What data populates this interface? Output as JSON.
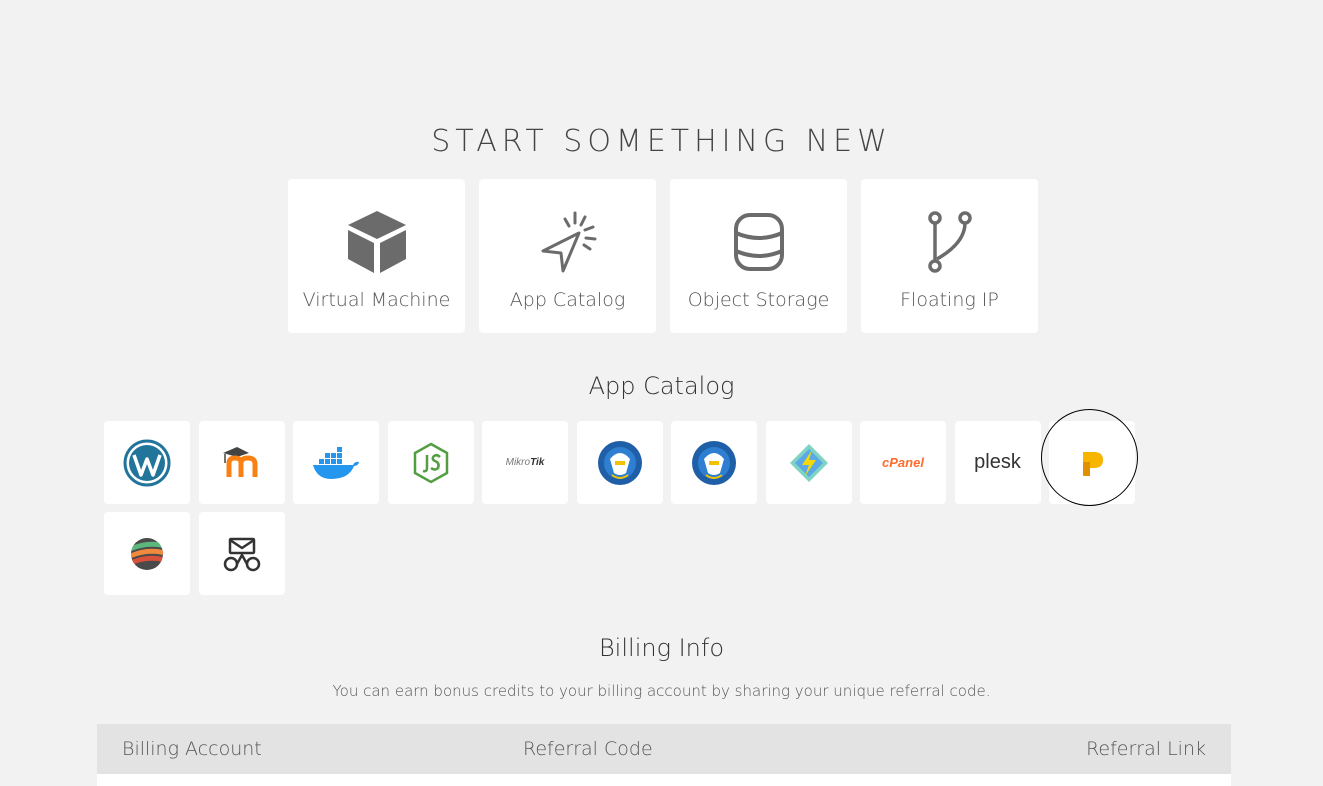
{
  "header": {
    "title": "START SOMETHING NEW"
  },
  "start_cards": [
    {
      "label": "Virtual Machine",
      "icon": "cube-icon"
    },
    {
      "label": "App Catalog",
      "icon": "cursor-click-icon"
    },
    {
      "label": "Object Storage",
      "icon": "database-icon"
    },
    {
      "label": "Floating IP",
      "icon": "branch-icon"
    }
  ],
  "app_catalog": {
    "heading": "App Catalog",
    "apps": [
      {
        "icon": "wordpress-icon"
      },
      {
        "icon": "moodle-icon"
      },
      {
        "icon": "docker-icon"
      },
      {
        "icon": "nodejs-icon"
      },
      {
        "icon": "mikrotik-logo",
        "text_a": "Mikro",
        "text_b": "Tik"
      },
      {
        "icon": "kemdikbud-logo"
      },
      {
        "icon": "kemdikbud-logo"
      },
      {
        "icon": "lightning-diamond-icon"
      },
      {
        "icon": "cpanel-logo",
        "text": "cPanel"
      },
      {
        "icon": "plesk-logo",
        "text": "plesk"
      },
      {
        "icon": "plausible-icon"
      },
      {
        "icon": "striped-sphere-icon"
      },
      {
        "icon": "mail-bike-icon"
      }
    ]
  },
  "billing": {
    "heading": "Billing Info",
    "description": "You can earn bonus credits to your billing account by sharing your unique referral code.",
    "columns": [
      "Billing Account",
      "Referral Code",
      "Referral Link"
    ]
  },
  "colors": {
    "background": "#f2f2f2",
    "card": "#ffffff",
    "icon_gray": "#6b6b6b",
    "wordpress": "#21759b",
    "moodle_orange": "#f98012",
    "docker_blue": "#2496ed",
    "node_green": "#539e43",
    "cpanel_orange": "#ff6c2c",
    "plausible_yellow": "#f7b500"
  }
}
